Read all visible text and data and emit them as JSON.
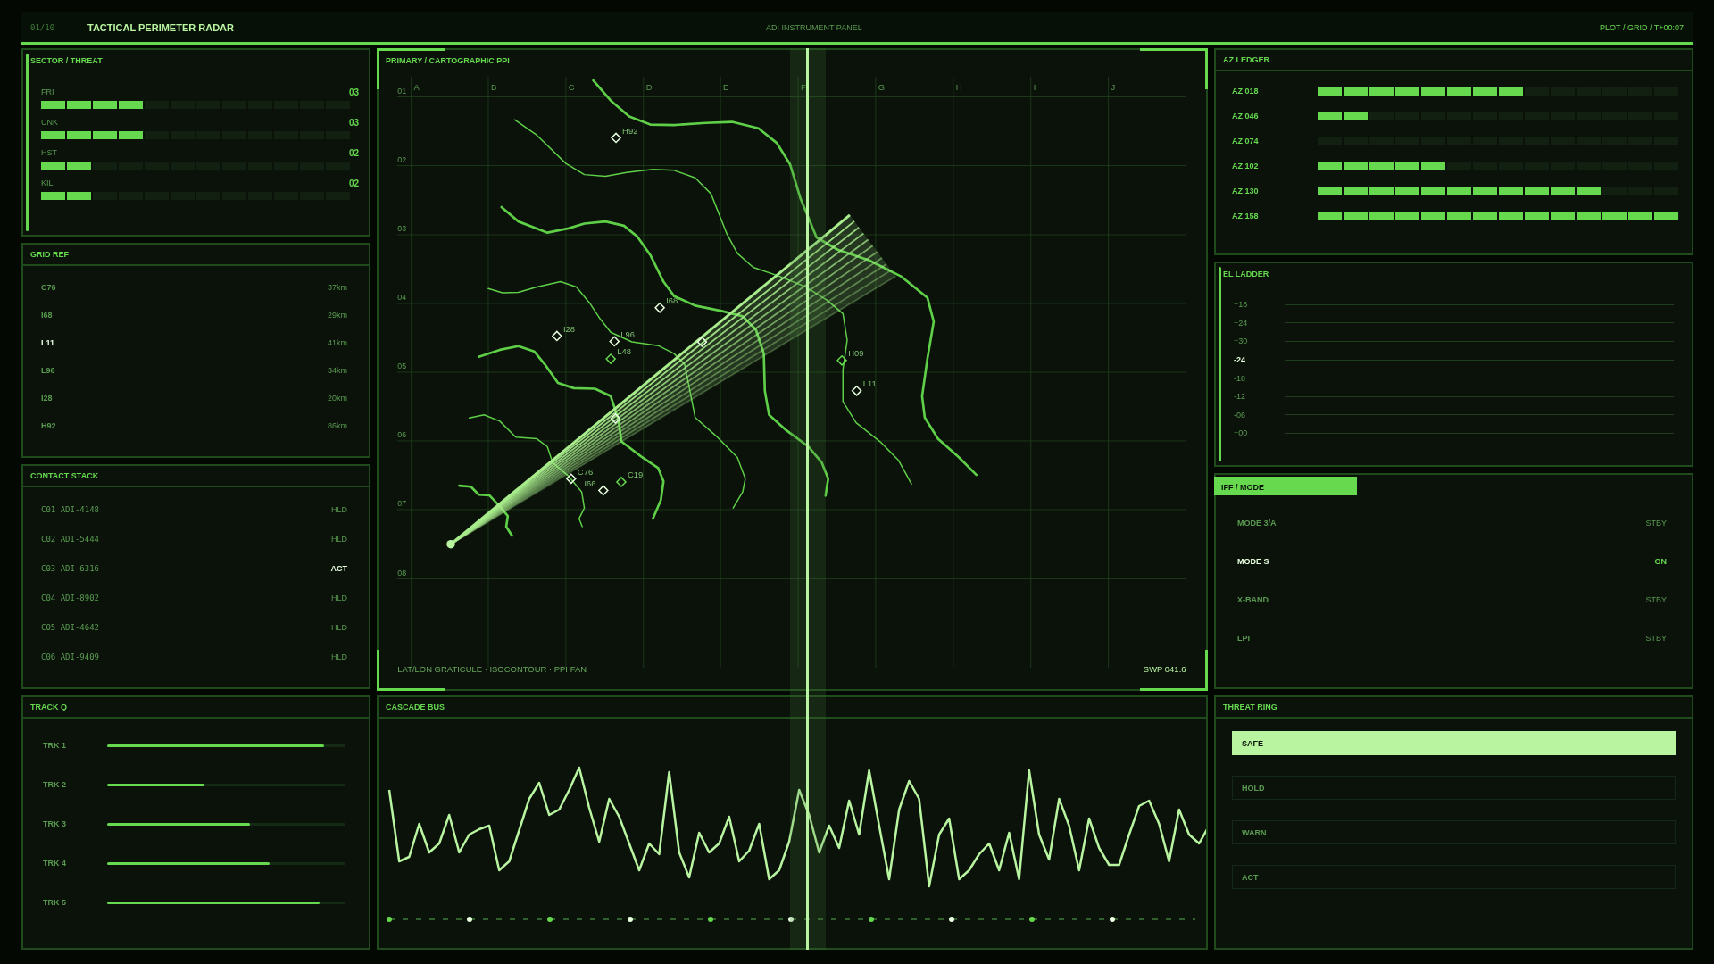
{
  "header": {
    "counter": "01/10",
    "title": "TACTICAL PERIMETER RADAR",
    "center": "ADI INSTRUMENT PANEL",
    "right": "PLOT / GRID / T+00:07"
  },
  "sector_threat": {
    "title": "SECTOR / THREAT",
    "rows": [
      {
        "label": "FRI",
        "value": "03",
        "level": 0.333
      },
      {
        "label": "UNK",
        "value": "03",
        "level": 0.333
      },
      {
        "label": "HST",
        "value": "02",
        "level": 0.167
      },
      {
        "label": "KIL",
        "value": "02",
        "level": 0.167
      }
    ]
  },
  "grid_ref": {
    "title": "GRID REF",
    "items": [
      {
        "label": "C76",
        "distance": "37km",
        "selected": false
      },
      {
        "label": "I68",
        "distance": "29km",
        "selected": false
      },
      {
        "label": "L11",
        "distance": "41km",
        "selected": true
      },
      {
        "label": "L96",
        "distance": "34km",
        "selected": false
      },
      {
        "label": "I28",
        "distance": "20km",
        "selected": false
      },
      {
        "label": "H92",
        "distance": "86km",
        "selected": false
      }
    ]
  },
  "contact_stack": {
    "title": "CONTACT STACK",
    "items": [
      {
        "id": "C01",
        "callsign": "ADI-4148",
        "status": "HLD",
        "selected": false
      },
      {
        "id": "C02",
        "callsign": "ADI-5444",
        "status": "HLD",
        "selected": false
      },
      {
        "id": "C03",
        "callsign": "ADI-6316",
        "status": "ACT",
        "selected": true
      },
      {
        "id": "C04",
        "callsign": "ADI-8902",
        "status": "HLD",
        "selected": false
      },
      {
        "id": "C05",
        "callsign": "ADI-4642",
        "status": "HLD",
        "selected": false
      },
      {
        "id": "C06",
        "callsign": "ADI-9409",
        "status": "HLD",
        "selected": false
      }
    ]
  },
  "track_q": {
    "title": "TRACK Q",
    "rows": [
      {
        "label": "TRK 1",
        "level": 0.91
      },
      {
        "label": "TRK 2",
        "level": 0.41
      },
      {
        "label": "TRK 3",
        "level": 0.6
      },
      {
        "label": "TRK 4",
        "level": 0.68
      },
      {
        "label": "TRK 5",
        "level": 0.89
      }
    ]
  },
  "map": {
    "title": "PRIMARY / CARTOGRAPHIC PPI",
    "columns": [
      "A",
      "B",
      "C",
      "D",
      "E",
      "F",
      "G",
      "H",
      "I",
      "J"
    ],
    "rows": [
      "01",
      "02",
      "03",
      "04",
      "05",
      "06",
      "07",
      "08"
    ],
    "markers": [
      {
        "label": "H92",
        "color": "#e8ffe0"
      },
      {
        "label": "I68",
        "color": "#e8ffe0"
      },
      {
        "label": "I28",
        "color": "#e8ffe0"
      },
      {
        "label": "L96",
        "color": "#e8ffe0"
      },
      {
        "label": "L48",
        "color": "#66d94f"
      },
      {
        "label": "C76",
        "color": "#e8ffe0"
      },
      {
        "label": "I66",
        "color": "#e8ffe0"
      },
      {
        "label": "C19",
        "color": "#66d94f"
      },
      {
        "label": "H09",
        "color": "#66d94f"
      },
      {
        "label": "L11",
        "color": "#e8ffe0"
      }
    ],
    "legend": "LAT/LON GRATICULE · ISOCONTOUR · PPI FAN",
    "sweep": "SWP 041.6"
  },
  "cascade_bus": {
    "title": "CASCADE BUS"
  },
  "az_ledger": {
    "title": "AZ LEDGER",
    "rows": [
      {
        "label": "AZ 018",
        "level": 0.571
      },
      {
        "label": "AZ 046",
        "level": 0.143
      },
      {
        "label": "AZ 074",
        "level": 0
      },
      {
        "label": "AZ 102",
        "level": 0.357
      },
      {
        "label": "AZ 130",
        "level": 0.786
      },
      {
        "label": "AZ 158",
        "level": 1
      }
    ]
  },
  "el_ladder": {
    "title": "EL LADDER",
    "items": [
      {
        "label": "+18",
        "selected": false
      },
      {
        "label": "+24",
        "selected": false
      },
      {
        "label": "+30",
        "selected": false
      },
      {
        "label": "-24",
        "selected": true
      },
      {
        "label": "-18",
        "selected": false
      },
      {
        "label": "-12",
        "selected": false
      },
      {
        "label": "-06",
        "selected": false
      },
      {
        "label": "+00",
        "selected": false
      }
    ]
  },
  "iff_mode": {
    "title": "IFF / MODE",
    "items": [
      {
        "label": "MODE 3/A",
        "status": "STBY",
        "selected": false
      },
      {
        "label": "MODE S",
        "status": "ON",
        "selected": true
      },
      {
        "label": "X-BAND",
        "status": "STBY",
        "selected": false
      },
      {
        "label": "LPI",
        "status": "STBY",
        "selected": false
      }
    ]
  },
  "threat_ring": {
    "title": "THREAT RING",
    "items": [
      {
        "label": "SAFE",
        "selected": true
      },
      {
        "label": "HOLD",
        "selected": false
      },
      {
        "label": "WARN",
        "selected": false
      },
      {
        "label": "ACT",
        "selected": false
      }
    ]
  }
}
